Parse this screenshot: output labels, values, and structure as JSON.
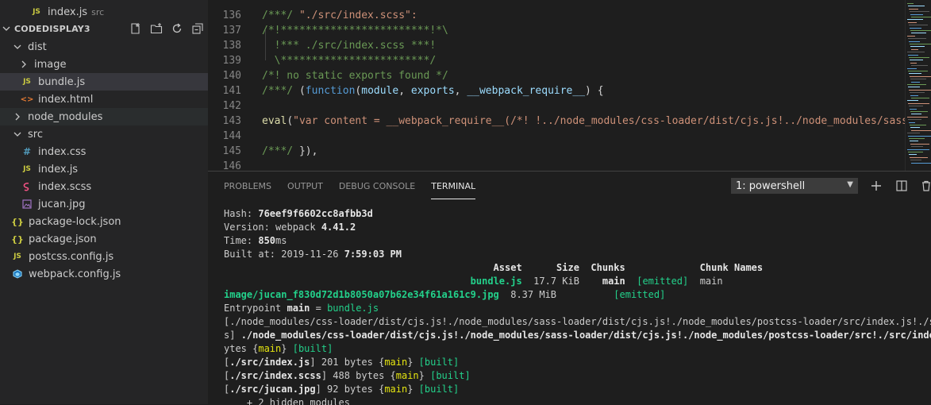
{
  "explorer": {
    "top_file": {
      "name": "index.js",
      "hint": "src"
    },
    "section_title": "CODEDISPLAY3",
    "actions": [
      "new-file-icon",
      "new-folder-icon",
      "refresh-icon",
      "collapse-all-icon"
    ],
    "items": [
      {
        "label": "dist",
        "type": "folder-open",
        "depth": 0
      },
      {
        "label": "image",
        "type": "folder-closed",
        "depth": 1
      },
      {
        "label": "bundle.js",
        "type": "js",
        "depth": 1
      },
      {
        "label": "index.html",
        "type": "html",
        "depth": 1
      },
      {
        "label": "node_modules",
        "type": "folder-closed",
        "depth": 0
      },
      {
        "label": "src",
        "type": "folder-open",
        "depth": 0
      },
      {
        "label": "index.css",
        "type": "css",
        "depth": 1
      },
      {
        "label": "index.js",
        "type": "js",
        "depth": 1
      },
      {
        "label": "index.scss",
        "type": "scss",
        "depth": 1
      },
      {
        "label": "jucan.jpg",
        "type": "image",
        "depth": 1
      },
      {
        "label": "package-lock.json",
        "type": "json",
        "depth": 0
      },
      {
        "label": "package.json",
        "type": "json",
        "depth": 0
      },
      {
        "label": "postcss.config.js",
        "type": "js",
        "depth": 0
      },
      {
        "label": "webpack.config.js",
        "type": "webpack",
        "depth": 0
      }
    ]
  },
  "editor": {
    "lines": [
      {
        "n": "136",
        "parts": [
          {
            "t": "/***/ ",
            "c": "comment"
          },
          {
            "t": "\"./src/index.scss\":",
            "c": "string"
          }
        ]
      },
      {
        "n": "137",
        "parts": [
          {
            "t": "/*!************************!*\\",
            "c": "comment"
          }
        ]
      },
      {
        "n": "138",
        "parts": [
          {
            "t": "  !*** ./src/index.scss ***!",
            "c": "comment"
          }
        ]
      },
      {
        "n": "139",
        "parts": [
          {
            "t": "  \\************************/",
            "c": "comment"
          }
        ]
      },
      {
        "n": "140",
        "parts": [
          {
            "t": "/*! no static exports found */",
            "c": "comment"
          }
        ]
      },
      {
        "n": "141",
        "parts": [
          {
            "t": "/***/ ",
            "c": "comment"
          },
          {
            "t": "(",
            "c": "punc"
          },
          {
            "t": "function",
            "c": "kw"
          },
          {
            "t": "(",
            "c": "punc"
          },
          {
            "t": "module",
            "c": "var"
          },
          {
            "t": ", ",
            "c": "punc"
          },
          {
            "t": "exports",
            "c": "var"
          },
          {
            "t": ", ",
            "c": "punc"
          },
          {
            "t": "__webpack_require__",
            "c": "var"
          },
          {
            "t": ") {",
            "c": "punc"
          }
        ]
      },
      {
        "n": "142",
        "parts": []
      },
      {
        "n": "143",
        "parts": [
          {
            "t": "eval",
            "c": "fn"
          },
          {
            "t": "(",
            "c": "punc"
          },
          {
            "t": "\"var content = __webpack_require__(/*! !../node_modules/css-loader/dist/cjs.js!../node_modules/sass-",
            "c": "string"
          }
        ]
      },
      {
        "n": "144",
        "parts": []
      },
      {
        "n": "145",
        "parts": [
          {
            "t": "/***/ ",
            "c": "comment"
          },
          {
            "t": "}),",
            "c": "punc"
          }
        ]
      },
      {
        "n": "146",
        "parts": []
      }
    ]
  },
  "panel": {
    "tabs": [
      "PROBLEMS",
      "OUTPUT",
      "DEBUG CONSOLE",
      "TERMINAL"
    ],
    "active_tab": "TERMINAL",
    "terminal_select": "1: powershell",
    "terminal_lines": [
      [
        {
          "t": "Hash: "
        },
        {
          "t": "76eef9f6602cc8afbb3d",
          "s": "b"
        }
      ],
      [
        {
          "t": "Version: webpack "
        },
        {
          "t": "4.41.2",
          "s": "b"
        }
      ],
      [
        {
          "t": "Time: "
        },
        {
          "t": "850",
          "s": "b"
        },
        {
          "t": "ms"
        }
      ],
      [
        {
          "t": "Built at: 2019-11-26 "
        },
        {
          "t": "7:59:03 PM",
          "s": "b"
        }
      ],
      [
        {
          "t": "                                               Asset      Size  Chunks             Chunk Names",
          "s": "b"
        }
      ],
      [
        {
          "t": "                                           "
        },
        {
          "t": "bundle.js",
          "s": "gbold"
        },
        {
          "t": "  17.7 KiB    "
        },
        {
          "t": "main",
          "s": "b"
        },
        {
          "t": "  "
        },
        {
          "t": "[emitted]",
          "s": "g"
        },
        {
          "t": "  main"
        }
      ],
      [
        {
          "t": "image/jucan_f830d72d1b8050a07b62e34f61a161c9.jpg",
          "s": "gbold"
        },
        {
          "t": "  8.37 MiB          "
        },
        {
          "t": "[emitted]",
          "s": "g"
        }
      ],
      [
        {
          "t": "Entrypoint "
        },
        {
          "t": "main",
          "s": "b"
        },
        {
          "t": " = "
        },
        {
          "t": "bundle.js",
          "s": "g"
        }
      ],
      [
        {
          "t": "[./node_modules/css-loader/dist/cjs.js!./node_modules/sass-loader/dist/cjs.js!./node_modules/postcss-loader/src/index.js!./src/"
        }
      ],
      [
        {
          "t": "s] "
        },
        {
          "t": "./node_modules/css-loader/dist/cjs.js!./node_modules/sass-loader/dist/cjs.js!./node_modules/postcss-loader/src!./src/index.sc",
          "s": "b"
        }
      ],
      [
        {
          "t": "ytes {"
        },
        {
          "t": "main",
          "s": "y"
        },
        {
          "t": "} "
        },
        {
          "t": "[built]",
          "s": "g"
        }
      ],
      [
        {
          "t": "["
        },
        {
          "t": "./src/index.js",
          "s": "b"
        },
        {
          "t": "] 201 bytes {"
        },
        {
          "t": "main",
          "s": "y"
        },
        {
          "t": "} "
        },
        {
          "t": "[built]",
          "s": "g"
        }
      ],
      [
        {
          "t": "["
        },
        {
          "t": "./src/index.scss",
          "s": "b"
        },
        {
          "t": "] 488 bytes {"
        },
        {
          "t": "main",
          "s": "y"
        },
        {
          "t": "} "
        },
        {
          "t": "[built]",
          "s": "g"
        }
      ],
      [
        {
          "t": "["
        },
        {
          "t": "./src/jucan.jpg",
          "s": "b"
        },
        {
          "t": "] 92 bytes {"
        },
        {
          "t": "main",
          "s": "y"
        },
        {
          "t": "} "
        },
        {
          "t": "[built]",
          "s": "g"
        }
      ],
      [
        {
          "t": "    + 2 hidden modules"
        }
      ]
    ]
  },
  "colors": {
    "sidebar_bg": "#252526",
    "editor_bg": "#1e1e1e",
    "selection_bg": "#37373d",
    "terminal_green": "#23d18b",
    "terminal_yellow": "#e5e510",
    "comment_green": "#6a9955",
    "string_orange": "#ce9178"
  }
}
